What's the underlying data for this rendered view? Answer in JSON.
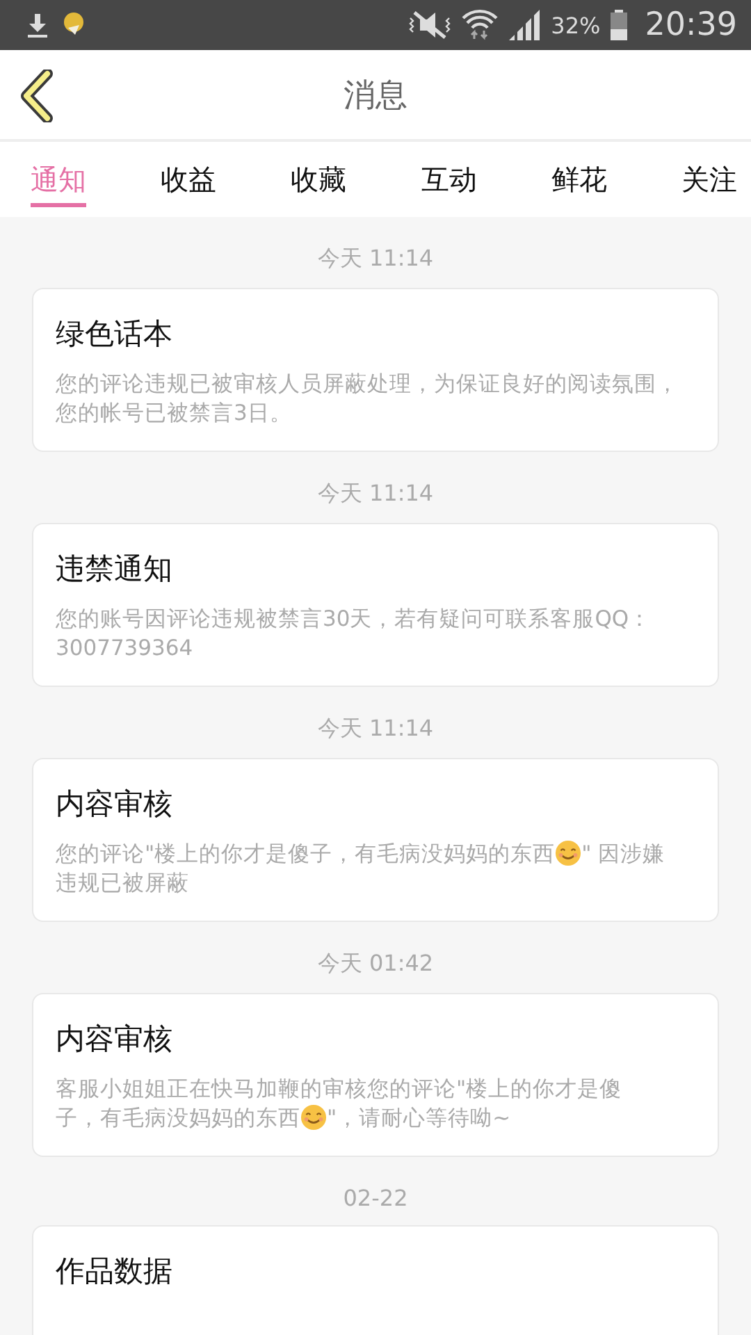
{
  "status_bar": {
    "battery": "32%",
    "time": "20:39"
  },
  "header": {
    "title": "消息"
  },
  "tabs": [
    {
      "label": "通知",
      "selected": true
    },
    {
      "label": "收益",
      "selected": false
    },
    {
      "label": "收藏",
      "selected": false
    },
    {
      "label": "互动",
      "selected": false
    },
    {
      "label": "鲜花",
      "selected": false
    },
    {
      "label": "关注",
      "selected": false
    }
  ],
  "messages": [
    {
      "time": "今天 11:14",
      "title": "绿色话本",
      "body": [
        [
          {
            "kind": "text",
            "text": "您的评论违规已被审核人员屏蔽处理，为保证良好的阅读氛围，您的帐号已被禁言3日。"
          }
        ]
      ]
    },
    {
      "time": "今天 11:14",
      "title": "违禁通知",
      "body": [
        [
          {
            "kind": "text",
            "text": "您的账号因评论违规被禁言30天，若有疑问可联系客服QQ：3007739364"
          }
        ]
      ]
    },
    {
      "time": "今天 11:14",
      "title": "内容审核",
      "body": [
        [
          {
            "kind": "text",
            "text": "您的评论\"楼上的你才是傻子，有毛病没妈妈的东西"
          },
          {
            "kind": "emoji"
          },
          {
            "kind": "text",
            "text": "\" 因涉嫌"
          }
        ],
        [
          {
            "kind": "text",
            "text": "违规已被屏蔽"
          }
        ]
      ]
    },
    {
      "time": "今天 01:42",
      "title": "内容审核",
      "body": [
        [
          {
            "kind": "text",
            "text": "客服小姐姐正在快马加鞭的审核您的评论\"楼上的你才是傻"
          }
        ],
        [
          {
            "kind": "text",
            "text": "子，有毛病没妈妈的东西"
          },
          {
            "kind": "emoji"
          },
          {
            "kind": "text",
            "text": "\"，请耐心等待呦~"
          }
        ]
      ]
    },
    {
      "time": "02-22",
      "title": "作品数据"
    }
  ]
}
